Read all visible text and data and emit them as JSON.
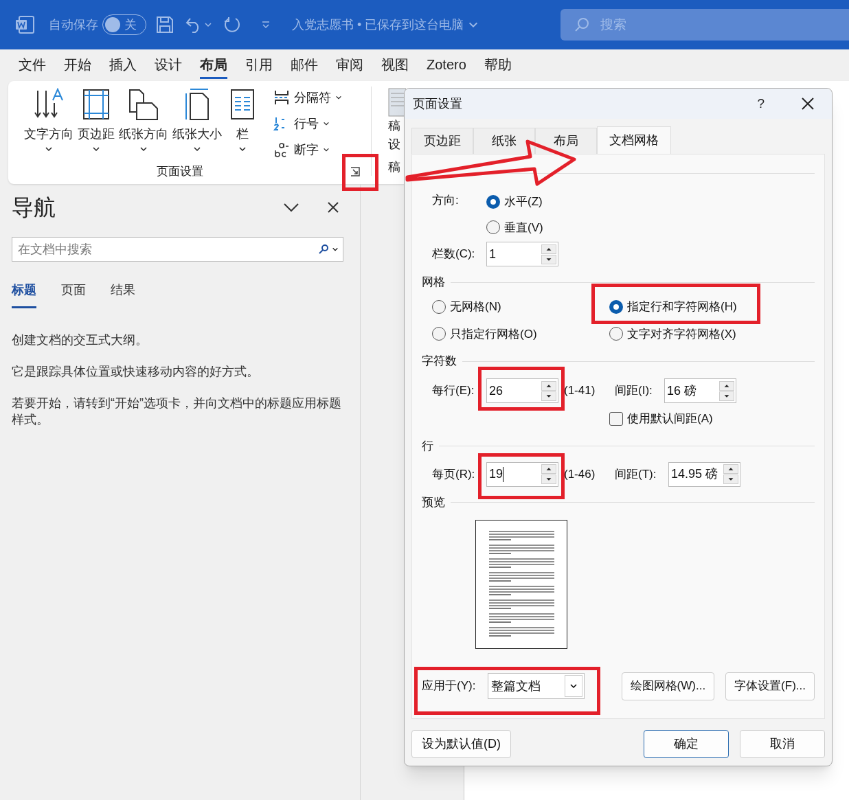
{
  "title_bar": {
    "autosave_label": "自动保存",
    "autosave_toggle": {
      "on": false,
      "label": "关"
    },
    "document_title": "入党志愿书 • 已保存到这台电脑",
    "search_placeholder": "搜索"
  },
  "menu_tabs": [
    {
      "label": "文件",
      "selected": false
    },
    {
      "label": "开始",
      "selected": false
    },
    {
      "label": "插入",
      "selected": false
    },
    {
      "label": "设计",
      "selected": false
    },
    {
      "label": "布局",
      "selected": true
    },
    {
      "label": "引用",
      "selected": false
    },
    {
      "label": "邮件",
      "selected": false
    },
    {
      "label": "审阅",
      "selected": false
    },
    {
      "label": "视图",
      "selected": false
    },
    {
      "label": "Zotero",
      "selected": false
    },
    {
      "label": "帮助",
      "selected": false
    }
  ],
  "ribbon": {
    "large_buttons": [
      {
        "label": "文字方向",
        "kind": "text-direction"
      },
      {
        "label": "页边距",
        "kind": "margins"
      },
      {
        "label": "纸张方向",
        "kind": "orientation"
      },
      {
        "label": "纸张大小",
        "kind": "size"
      },
      {
        "label": "栏",
        "kind": "columns"
      }
    ],
    "small_buttons": [
      {
        "label": "分隔符",
        "kind": "breaks"
      },
      {
        "label": "行号",
        "kind": "line-numbers"
      },
      {
        "label": "断字",
        "kind": "hyphenation"
      }
    ],
    "group_label": "页面设置",
    "partial_labels": [
      "稿",
      "设",
      "稿"
    ]
  },
  "navigation": {
    "title": "导航",
    "search_placeholder": "在文档中搜索",
    "tabs": [
      {
        "label": "标题",
        "selected": true
      },
      {
        "label": "页面",
        "selected": false
      },
      {
        "label": "结果",
        "selected": false
      }
    ],
    "paragraphs": [
      "创建文档的交互式大纲。",
      "它是跟踪具体位置或快速移动内容的好方式。",
      "若要开始，请转到“开始”选项卡，并向文档中的标题应用标题样式。"
    ]
  },
  "dialog": {
    "title": "页面设置",
    "help": "?",
    "tabs": [
      {
        "label": "页边距",
        "selected": false
      },
      {
        "label": "纸张",
        "selected": false
      },
      {
        "label": "布局",
        "selected": false
      },
      {
        "label": "文档网格",
        "selected": true
      }
    ],
    "direction": {
      "label": "方向:",
      "options": [
        {
          "label": "水平(Z)",
          "selected": true
        },
        {
          "label": "垂直(V)",
          "selected": false
        }
      ]
    },
    "columns": {
      "label": "栏数(C):",
      "value": "1"
    },
    "grid": {
      "label": "网格",
      "options": [
        {
          "label": "无网格(N)",
          "selected": false
        },
        {
          "label": "指定行和字符网格(H)",
          "selected": true
        },
        {
          "label": "只指定行网格(O)",
          "selected": false
        },
        {
          "label": "文字对齐字符网格(X)",
          "selected": false
        }
      ]
    },
    "characters": {
      "label": "字符数",
      "per_line_label": "每行(E):",
      "per_line": "26",
      "range": "(1-41)",
      "pitch_label": "间距(I):",
      "pitch": "16 磅",
      "default_pitch": {
        "label": "使用默认间距(A)",
        "checked": false
      }
    },
    "lines": {
      "label": "行",
      "per_page_label": "每页(R):",
      "per_page": "19",
      "range": "(1-46)",
      "pitch_label": "间距(T):",
      "pitch": "14.95 磅"
    },
    "preview_label": "预览",
    "apply": {
      "label": "应用于(Y):",
      "value": "整篇文档"
    },
    "panel_buttons": [
      "绘图网格(W)...",
      "字体设置(F)..."
    ],
    "footer": {
      "default_button": "设为默认值(D)",
      "ok": "确定",
      "cancel": "取消"
    }
  }
}
